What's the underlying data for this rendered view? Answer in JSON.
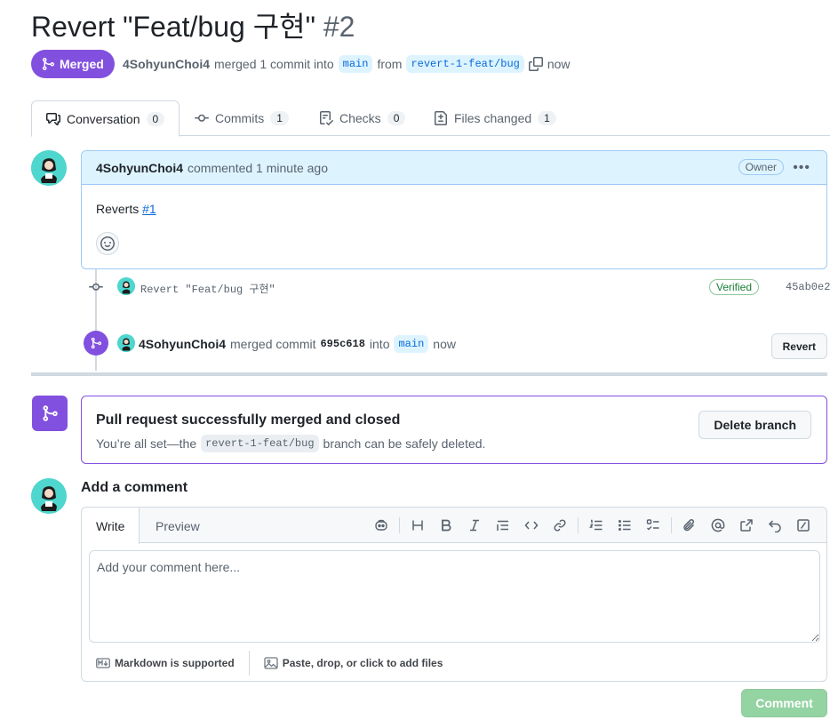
{
  "pr": {
    "title": "Revert \"Feat/bug 구현\"",
    "number": "#2",
    "state": "Merged",
    "author": "4SohyunChoi4",
    "merged_text": "merged 1 commit into",
    "base_branch": "main",
    "from_text": "from",
    "head_branch": "revert-1-feat/bug",
    "time": "now"
  },
  "tabs": [
    {
      "label": "Conversation",
      "count": "0"
    },
    {
      "label": "Commits",
      "count": "1"
    },
    {
      "label": "Checks",
      "count": "0"
    },
    {
      "label": "Files changed",
      "count": "1"
    }
  ],
  "comment": {
    "author": "4SohyunChoi4",
    "action": "commented 1 minute ago",
    "role": "Owner",
    "body_prefix": "Reverts",
    "body_link": "#1"
  },
  "commit": {
    "message": "Revert \"Feat/bug 구현\"",
    "verified": "Verified",
    "sha": "45ab0e2"
  },
  "merge_event": {
    "author": "4SohyunChoi4",
    "text1": "merged commit",
    "sha": "695c618",
    "text2": "into",
    "branch": "main",
    "time": "now",
    "revert_label": "Revert"
  },
  "merged_box": {
    "title": "Pull request successfully merged and closed",
    "sub_prefix": "You’re all set—the",
    "branch": "revert-1-feat/bug",
    "sub_suffix": "branch can be safely deleted.",
    "delete_label": "Delete branch"
  },
  "add_comment": {
    "heading": "Add a comment",
    "tab_write": "Write",
    "tab_preview": "Preview",
    "placeholder": "Add your comment here...",
    "markdown_note": "Markdown is supported",
    "attach_note": "Paste, drop, or click to add files",
    "submit_label": "Comment"
  },
  "colors": {
    "merged_purple": "#8250df",
    "link_blue": "#0969da",
    "comment_header_bg": "#ddf4ff",
    "verified_green": "#1a7f37",
    "comment_button_disabled": "#94d3a2"
  },
  "icons": [
    "git-merge-icon",
    "copy-icon",
    "conversation-icon",
    "commit-icon",
    "checks-icon",
    "file-diff-icon",
    "kebab-icon",
    "smiley-icon",
    "copilot-icon",
    "heading-icon",
    "bold-icon",
    "italic-icon",
    "quote-icon",
    "code-icon",
    "link-icon",
    "ordered-list-icon",
    "unordered-list-icon",
    "task-list-icon",
    "paperclip-icon",
    "mention-icon",
    "reference-icon",
    "undo-icon",
    "slash-command-icon",
    "markdown-icon",
    "image-icon"
  ]
}
